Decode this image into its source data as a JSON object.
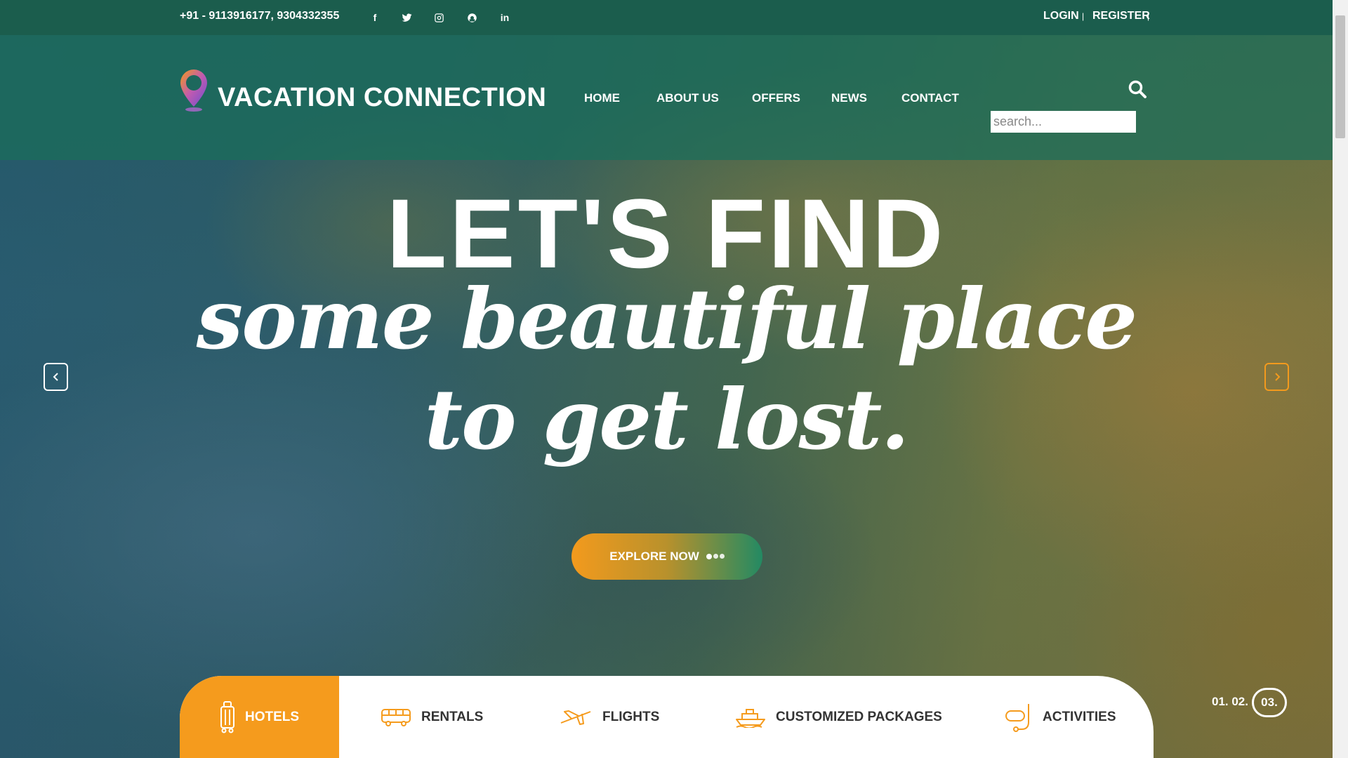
{
  "topbar": {
    "phone": "+91 - 9113916177, 9304332355",
    "social": [
      {
        "icon": "facebook-icon",
        "glyph": "f"
      },
      {
        "icon": "twitter-icon"
      },
      {
        "icon": "instagram-icon"
      },
      {
        "icon": "skype-icon"
      },
      {
        "icon": "linkedin-icon",
        "glyph": "in"
      }
    ],
    "login": "LOGIN",
    "register": "REGISTER",
    "separator": "|"
  },
  "header": {
    "logo_text": "VACATION CONNECTION",
    "nav": [
      "HOME",
      "ABOUT US",
      "OFFERS",
      "NEWS",
      "CONTACT"
    ],
    "search_placeholder": "search..."
  },
  "hero": {
    "line1": "LET'S FIND",
    "line2": "some beautiful place",
    "line3": "to get lost.",
    "cta": "EXPLORE NOW",
    "pager_prefix": "01. 02.",
    "pager_current": "03."
  },
  "tabs": [
    {
      "label": "HOTELS",
      "icon": "luggage-icon",
      "active": true
    },
    {
      "label": "RENTALS",
      "icon": "bus-icon",
      "active": false
    },
    {
      "label": "FLIGHTS",
      "icon": "airplane-icon",
      "active": false
    },
    {
      "label": "CUSTOMIZED PACKAGES",
      "icon": "ship-icon",
      "active": false
    },
    {
      "label": "ACTIVITIES",
      "icon": "snorkel-icon",
      "active": false
    }
  ],
  "colors": {
    "brand_green": "#1b5d4d",
    "accent_orange": "#f59b1d"
  }
}
